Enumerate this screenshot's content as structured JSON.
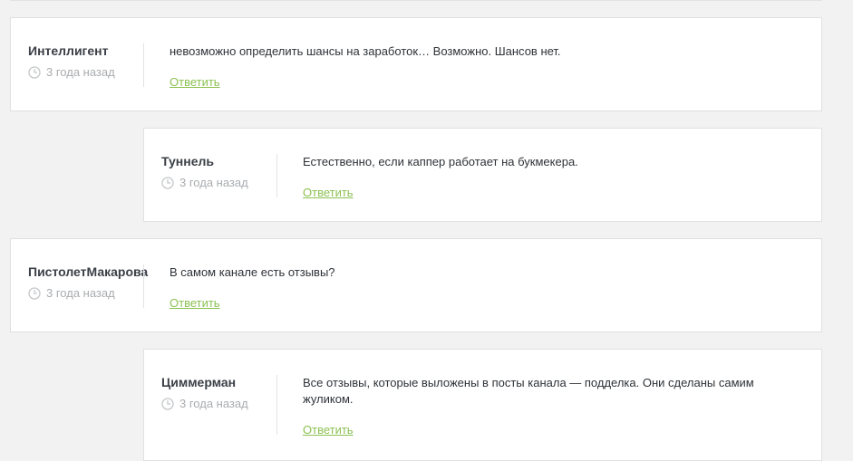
{
  "comments": [
    {
      "author": "Интеллигент",
      "time": "3 года назад",
      "text": "невозможно определить шансы на заработок… Возможно. Шансов нет.",
      "reply_label": "Ответить"
    },
    {
      "author": "Туннель",
      "time": "3 года назад",
      "text": "Естественно, если каппер работает на букмекера.",
      "reply_label": "Ответить"
    },
    {
      "author": "ПистолетМакарова",
      "time": "3 года назад",
      "text": "В самом канале есть отзывы?",
      "reply_label": "Ответить"
    },
    {
      "author": "Циммерман",
      "time": "3 года назад",
      "text": "Все отзывы, которые выложены в посты канала — подделка. Они сделаны самим жуликом.",
      "reply_label": "Ответить"
    }
  ],
  "colors": {
    "reply_link": "#8cc152",
    "author": "#3a3f46",
    "time": "#a9acaf",
    "text": "#2e3237"
  },
  "icons": {
    "time": "clock-icon"
  }
}
